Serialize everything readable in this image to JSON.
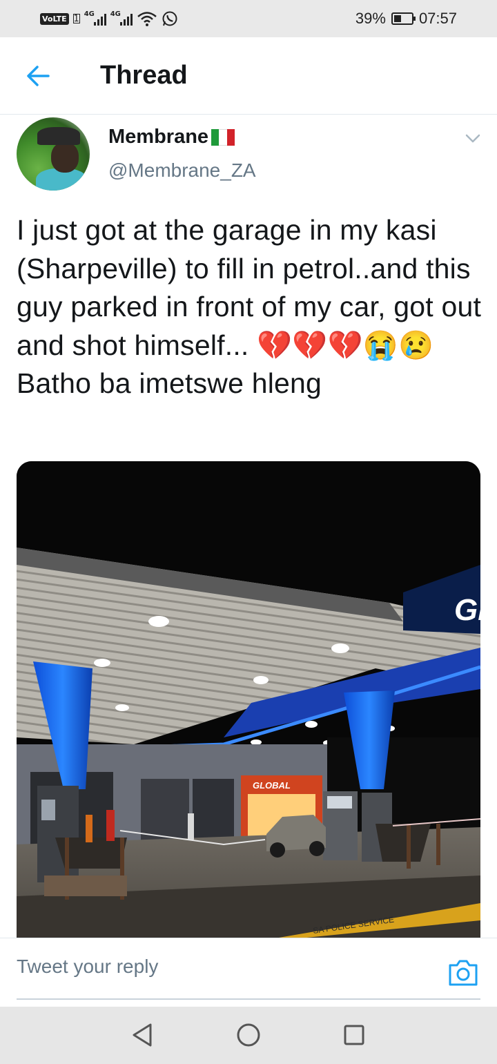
{
  "status_bar": {
    "volte": "VoLTE",
    "sim": "1",
    "net1": "4G",
    "net2": "4G",
    "battery": "39%",
    "time": "07:57",
    "icons": [
      "signal-icon",
      "wifi-icon",
      "whatsapp-icon",
      "battery-icon"
    ]
  },
  "header": {
    "title": "Thread",
    "back_icon": "arrow-left-icon"
  },
  "tweet": {
    "display_name": "Membrane",
    "flag": "italy-flag",
    "handle": "@Membrane_ZA",
    "text": "I just got at the garage in my kasi (Sharpeville)  to fill in petrol..and this guy parked in front of my car, got out and shot himself... 💔💔💔😭😢 Batho ba imetswe hleng",
    "menu_icon": "chevron-down-icon"
  },
  "photo": {
    "canopy_sign": "GL",
    "shop_sign": "GLOBAL",
    "tape_text": "SA POLICE SERVICE"
  },
  "reply": {
    "placeholder": "Tweet your reply",
    "camera_icon": "camera-icon"
  },
  "nav": {
    "icons": [
      "back-triangle-icon",
      "home-circle-icon",
      "recents-square-icon"
    ]
  },
  "colors": {
    "accent": "#1da1f2",
    "text": "#14171a",
    "muted": "#657786",
    "canopy_blue": "#1e6cff"
  }
}
